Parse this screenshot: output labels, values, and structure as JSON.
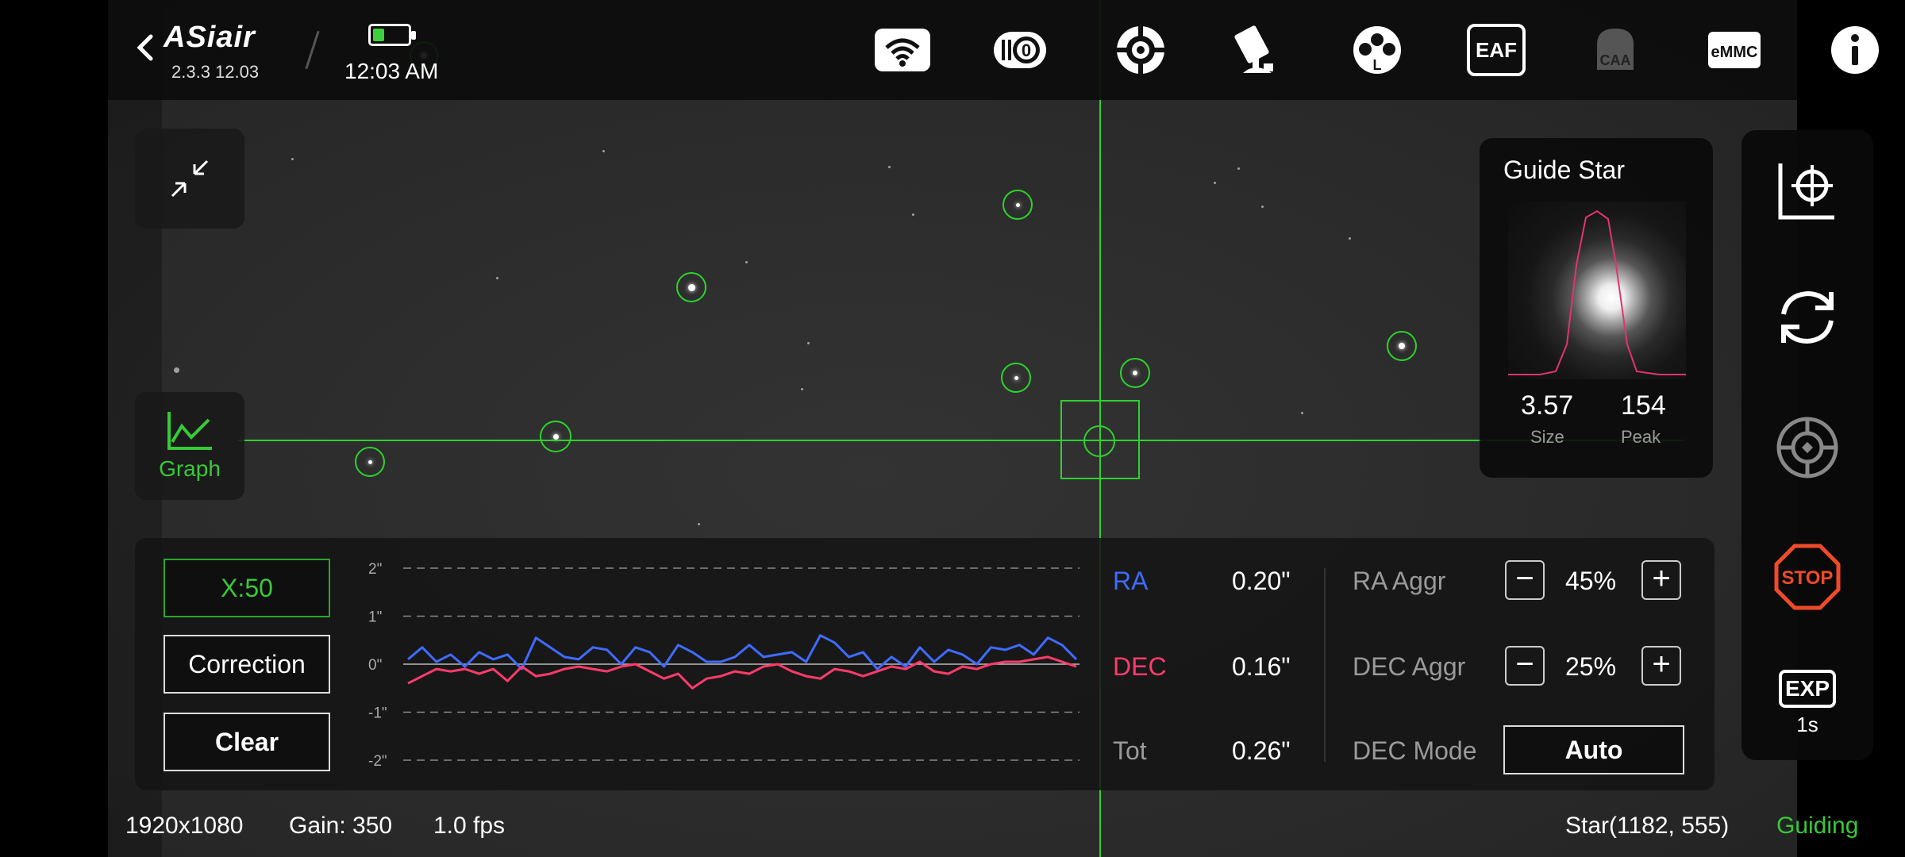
{
  "header": {
    "app_name": "ASiair",
    "version": "2.3.3 12.03",
    "time": "12:03 AM",
    "battery_icon": "battery-icon",
    "icons": [
      "wifi-icon",
      "camera-icon",
      "guide-scope-icon",
      "telescope-mount-icon",
      "filter-wheel-icon",
      "eaf-icon",
      "caa-icon",
      "emmc-icon",
      "info-icon"
    ],
    "eaf_label": "EAF",
    "caa_label": "CAA",
    "emmc_label": "eMMC",
    "filter_label": "L"
  },
  "side_buttons": {
    "collapse_icon": "collapse-icon",
    "graph_label": "Graph"
  },
  "guide_star": {
    "title": "Guide Star",
    "size_value": "3.57",
    "size_label": "Size",
    "peak_value": "154",
    "peak_label": "Peak"
  },
  "right_toolbar": {
    "icons": [
      "calibrate-icon",
      "refresh-icon",
      "target-icon",
      "stop-icon",
      "exposure-icon"
    ],
    "stop_label": "STOP",
    "exp_label": "EXP",
    "exp_value": "1s"
  },
  "guide_controls": {
    "x_scale_label": "X:50",
    "correction_label": "Correction",
    "clear_label": "Clear"
  },
  "metrics": {
    "ra_label": "RA",
    "ra_value": "0.20\"",
    "dec_label": "DEC",
    "dec_value": "0.16\"",
    "tot_label": "Tot",
    "tot_value": "0.26\"",
    "ra_aggr_label": "RA Aggr",
    "ra_aggr_value": "45%",
    "dec_aggr_label": "DEC Aggr",
    "dec_aggr_value": "25%",
    "dec_mode_label": "DEC Mode",
    "dec_mode_value": "Auto",
    "colors": {
      "ra": "#3f6bff",
      "dec": "#ff3b6b"
    }
  },
  "chart_data": {
    "type": "line",
    "yticks": [
      "2\"",
      "1\"",
      "0\"",
      "-1\"",
      "-2\""
    ],
    "ylim": [
      -2,
      2
    ],
    "series": [
      {
        "name": "RA",
        "values": [
          0.1,
          0.35,
          0.05,
          0.2,
          -0.05,
          0.25,
          0.1,
          0.2,
          -0.1,
          0.55,
          0.35,
          0.15,
          0.1,
          0.35,
          0.3,
          0.0,
          0.35,
          0.25,
          -0.05,
          0.4,
          0.25,
          0.05,
          0.05,
          0.15,
          0.4,
          0.15,
          0.2,
          0.25,
          0.05,
          0.6,
          0.45,
          0.15,
          0.25,
          -0.1,
          0.15,
          -0.05,
          0.35,
          0.05,
          0.3,
          0.2,
          0.0,
          0.35,
          0.3,
          0.4,
          0.2,
          0.55,
          0.4,
          0.1
        ]
      },
      {
        "name": "DEC",
        "values": [
          -0.4,
          -0.25,
          -0.1,
          -0.15,
          -0.1,
          -0.2,
          -0.1,
          -0.35,
          -0.05,
          -0.25,
          -0.2,
          -0.1,
          -0.05,
          -0.1,
          -0.15,
          -0.05,
          0.0,
          -0.15,
          -0.3,
          -0.2,
          -0.5,
          -0.3,
          -0.25,
          -0.15,
          -0.2,
          -0.05,
          0.0,
          -0.15,
          -0.25,
          -0.3,
          -0.1,
          -0.15,
          -0.25,
          -0.15,
          -0.05,
          -0.1,
          0.05,
          -0.15,
          -0.2,
          -0.05,
          -0.1,
          0.0,
          0.05,
          0.05,
          0.1,
          0.15,
          0.05,
          -0.05
        ]
      }
    ]
  },
  "status": {
    "resolution": "1920x1080",
    "gain": "Gain: 350",
    "fps": "1.0 fps",
    "star_position": "Star(1182, 555)",
    "state": "Guiding"
  }
}
